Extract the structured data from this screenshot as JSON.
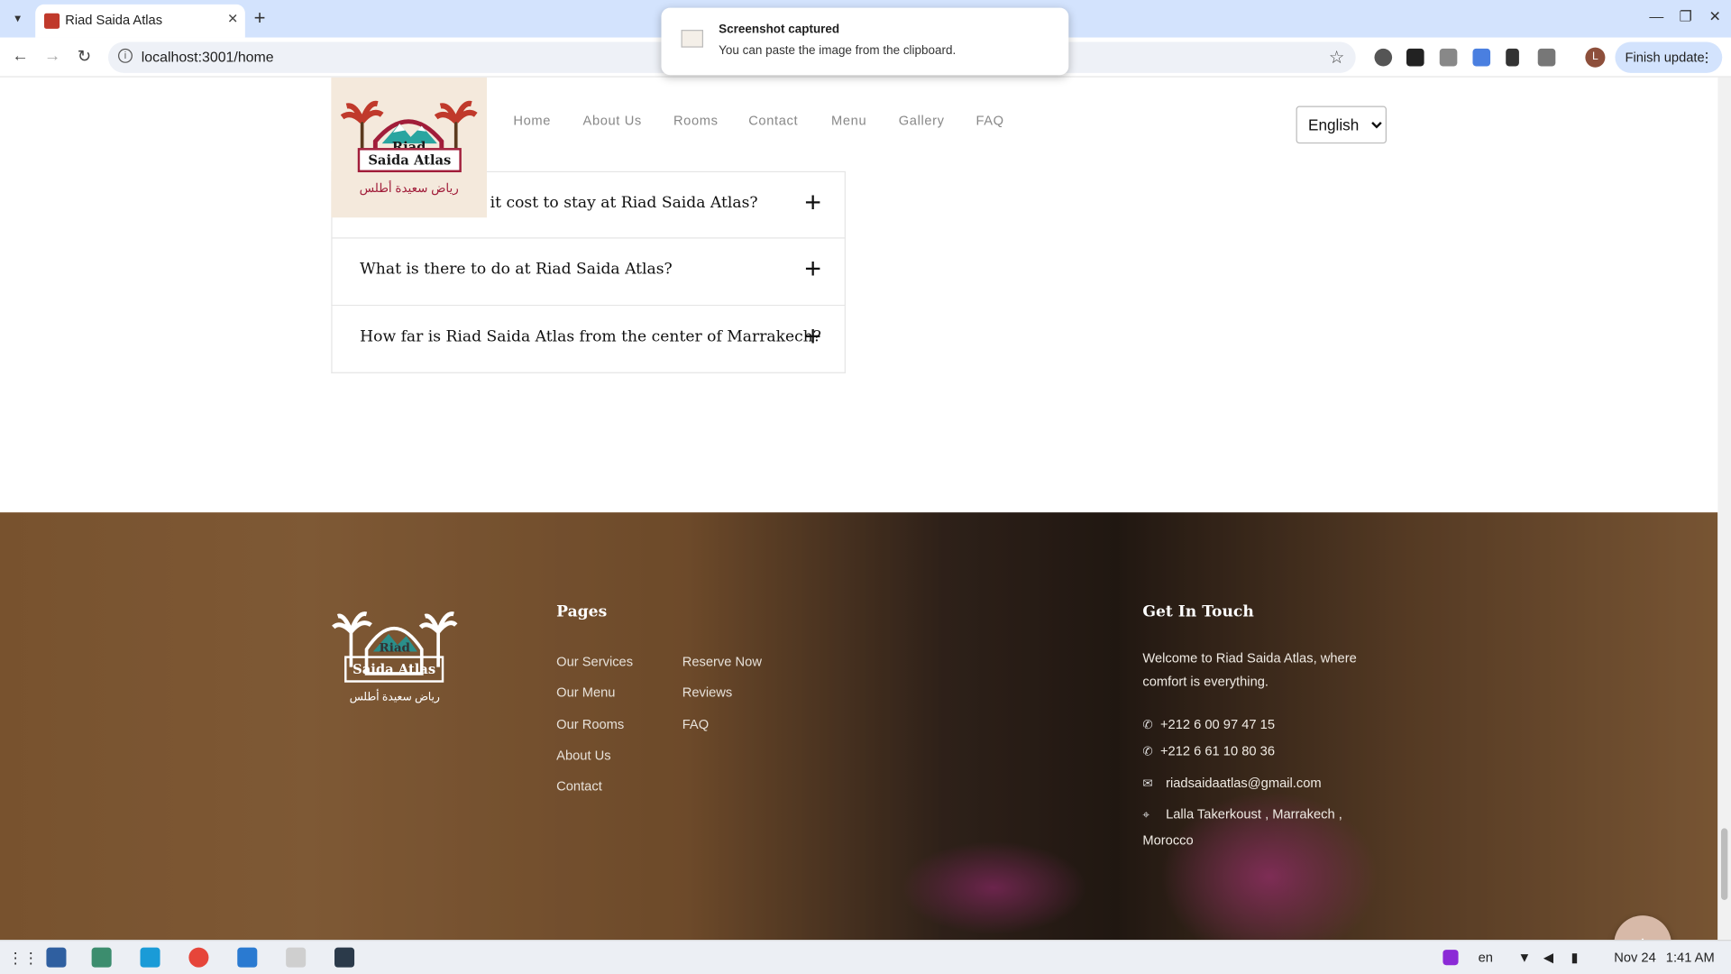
{
  "browser": {
    "tab_title": "Riad Saida Atlas",
    "url": "localhost:3001/home",
    "finish_update_label": "Finish update",
    "profile_initial": "L"
  },
  "toast": {
    "title": "Screenshot captured",
    "body": "You can paste the image from the clipboard."
  },
  "site_nav": {
    "items": [
      "Home",
      "About Us",
      "Rooms",
      "Contact",
      "Menu",
      "Gallery",
      "FAQ"
    ],
    "language": "English"
  },
  "logo": {
    "line1": "Riad",
    "line2": "Saida Atlas",
    "arabic": "رياض سعيدة أطلس"
  },
  "faq": {
    "questions": [
      "How much does it cost to stay at Riad Saida Atlas?",
      "What is there to do at Riad Saida Atlas?",
      "How far is Riad Saida Atlas from the center of Marrakech?"
    ]
  },
  "footer": {
    "pages_heading": "Pages",
    "pages_col1": [
      "Our Services",
      "Our Menu",
      "Our Rooms",
      "About Us",
      "Contact"
    ],
    "pages_col2": [
      "Reserve Now",
      "Reviews",
      "FAQ"
    ],
    "contact_heading": "Get In Touch",
    "contact_intro": "Welcome to Riad Saida Atlas, where comfort is everything.",
    "phone1": "+212 6 00 97 47 15",
    "phone2": "+212 6 61 10 80 36",
    "email": "riadsaidaatlas@gmail.com",
    "address_line1": "Lalla Takerkoust , Marrakech ,",
    "address_line2": "Morocco"
  },
  "taskbar": {
    "lang": "en",
    "date": "Nov 24",
    "time": "1:41 AM"
  },
  "colors": {
    "tabbar_bg": "#d3e3fd",
    "logo_bg": "#f4e9dc",
    "back_to_top": "#d7b9a8"
  }
}
